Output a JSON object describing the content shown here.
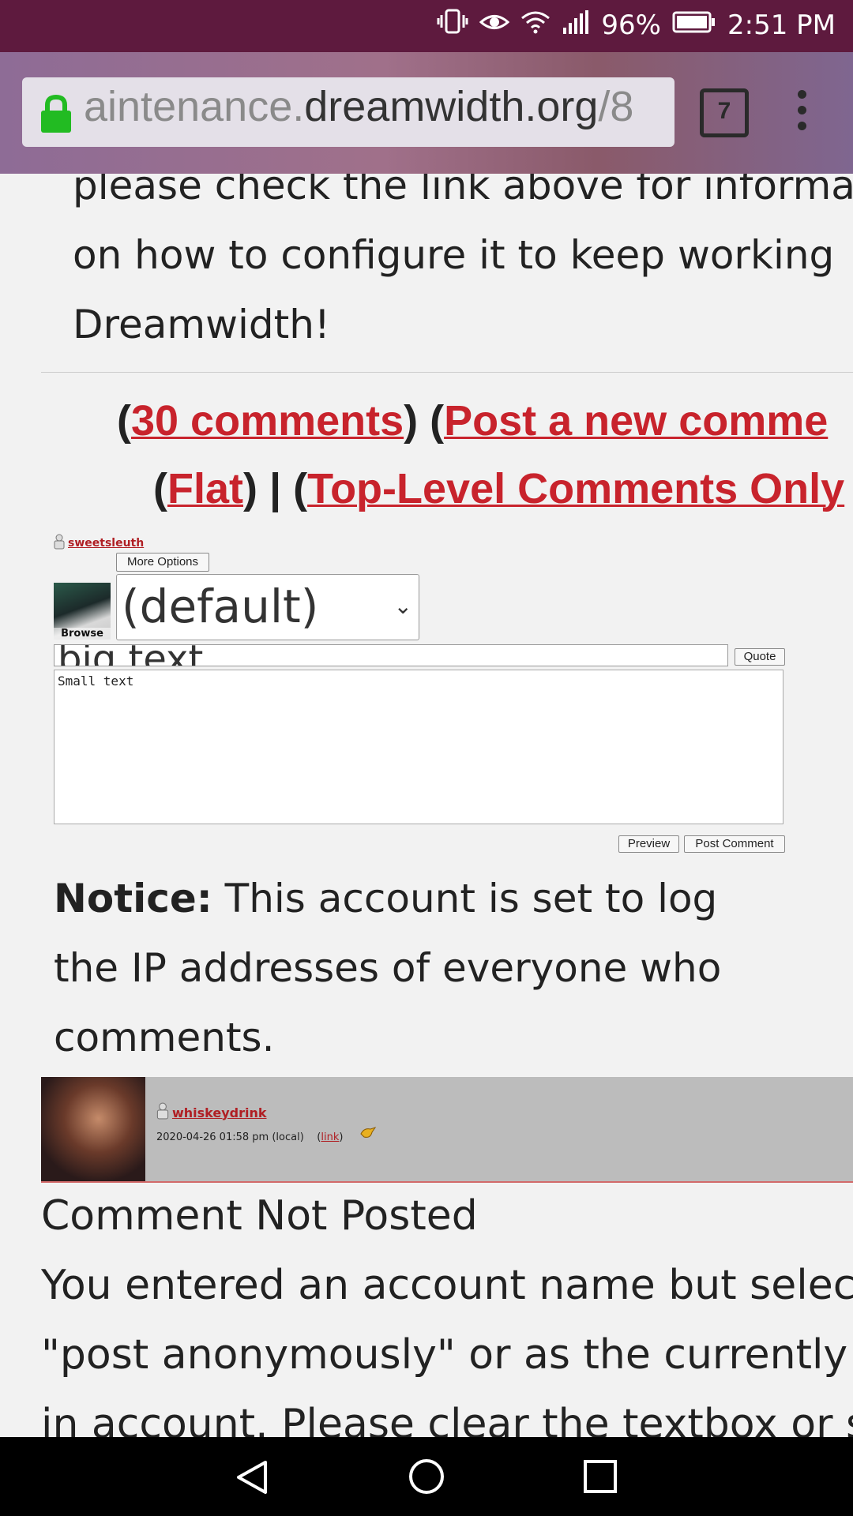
{
  "status_bar": {
    "battery": "96%",
    "time": "2:51 PM",
    "icons": [
      "vibrate-icon",
      "eye-icon",
      "wifi-icon",
      "signal-icon",
      "battery-icon"
    ],
    "background": "#5e1a3e"
  },
  "browser": {
    "url_prefix": "aintenance.",
    "url_domain": "dreamwidth.org",
    "url_suffix": "/8",
    "tab_count": "7"
  },
  "article": {
    "lines": [
      "please check the link above for informa",
      "on how to configure it to keep working",
      "Dreamwidth!"
    ]
  },
  "comment_links": {
    "comments_link": "30 comments",
    "post_link": "Post a new comme",
    "flat_link": "Flat",
    "toplevel_link": "Top-Level Comments Only",
    "sep": " | "
  },
  "reply_form": {
    "username": "sweetsleuth",
    "more_options": "More Options",
    "browse": "Browse",
    "icon_select": "(default)",
    "subject": "big text",
    "quote": "Quote",
    "body": "Small text",
    "preview": "Preview",
    "post_comment": "Post Comment"
  },
  "notice": {
    "label": "Notice:",
    "text": " This account is set to log the IP addresses of everyone who comments."
  },
  "comment": {
    "username": "whiskeydrink",
    "date": "2020-04-26 01:58 pm (local)",
    "link": "link"
  },
  "error": {
    "title": "Comment Not Posted",
    "lines": [
      "You entered an account name but select",
      "\"post anonymously\" or as the currently lo",
      "in account. Please clear the textbox or s"
    ]
  },
  "colors": {
    "link": "#c8232c",
    "comment_header": "#bcbcbc"
  }
}
